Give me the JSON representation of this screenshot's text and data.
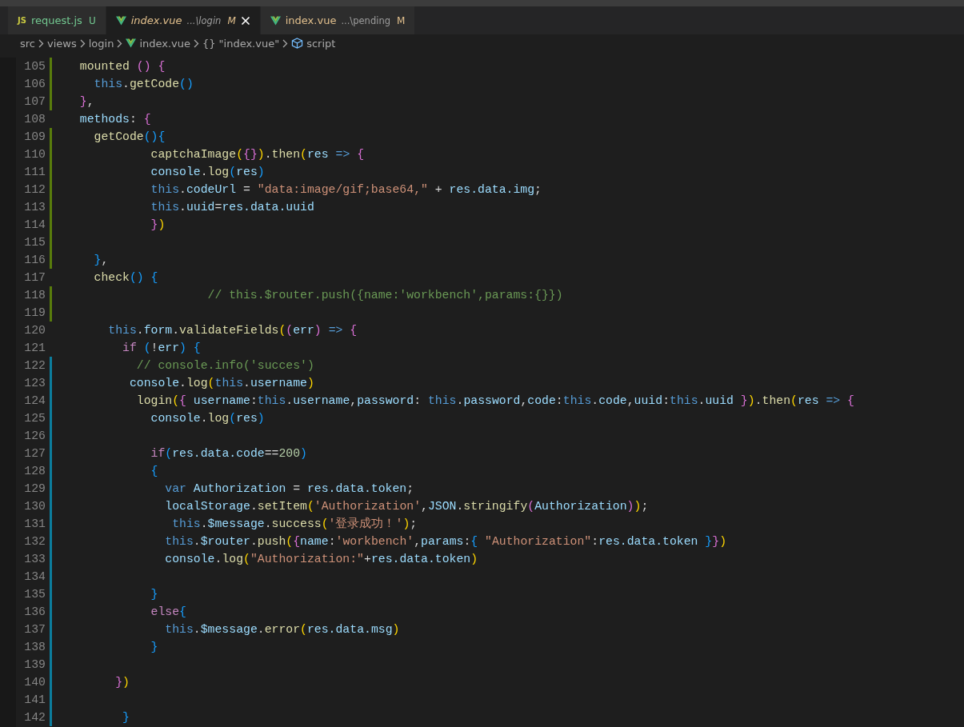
{
  "tabs": [
    {
      "kind": "js",
      "badge": "JS",
      "name": "request.js",
      "untracked": true,
      "git_letter": "U",
      "selected": false,
      "preview": false
    },
    {
      "kind": "vue",
      "name": "index.vue",
      "path": "...\\login",
      "untracked": false,
      "git_letter": "M",
      "selected": true,
      "preview": true
    },
    {
      "kind": "vue",
      "name": "index.vue",
      "path": "...\\pending",
      "untracked": false,
      "git_letter": "M",
      "selected": false,
      "preview": false
    }
  ],
  "breadcrumbs": [
    {
      "kind": "folder",
      "label": "src"
    },
    {
      "kind": "folder",
      "label": "views"
    },
    {
      "kind": "folder",
      "label": "login"
    },
    {
      "kind": "vue",
      "label": "index.vue"
    },
    {
      "kind": "object",
      "symbol": "{}",
      "label": "\"index.vue\""
    },
    {
      "kind": "module",
      "label": "script"
    }
  ],
  "lines": [
    {
      "number": "105",
      "kind": "added",
      "tokens": [
        {
          "text": "  mounted ",
          "kind": "f"
        },
        {
          "text": "() {",
          "kind": "b2"
        }
      ]
    },
    {
      "number": "106",
      "kind": "added",
      "tokens": [
        {
          "text": "    this",
          "kind": "k"
        },
        {
          "text": ".",
          "kind": "p"
        },
        {
          "text": "getCode",
          "kind": "f"
        },
        {
          "text": "()",
          "kind": "b3"
        }
      ]
    },
    {
      "number": "107",
      "kind": "added",
      "tokens": [
        {
          "text": "  }",
          "kind": "b2"
        },
        {
          "text": ",",
          "kind": "p"
        }
      ]
    },
    {
      "number": "108",
      "kind": "unchanged",
      "tokens": [
        {
          "text": "  methods",
          "kind": "v"
        },
        {
          "text": ": ",
          "kind": "p"
        },
        {
          "text": "{",
          "kind": "b2"
        }
      ]
    },
    {
      "number": "109",
      "kind": "added",
      "tokens": [
        {
          "text": "    getCode",
          "kind": "f"
        },
        {
          "text": "(){",
          "kind": "b3"
        }
      ]
    },
    {
      "number": "110",
      "kind": "added",
      "tokens": [
        {
          "text": "            captchaImage",
          "kind": "f"
        },
        {
          "text": "(",
          "kind": "b1"
        },
        {
          "text": "{}",
          "kind": "b2"
        },
        {
          "text": ")",
          "kind": "b1"
        },
        {
          "text": ".",
          "kind": "p"
        },
        {
          "text": "then",
          "kind": "f"
        },
        {
          "text": "(",
          "kind": "b1"
        },
        {
          "text": "res ",
          "kind": "v"
        },
        {
          "text": "=> ",
          "kind": "k"
        },
        {
          "text": "{",
          "kind": "b2"
        }
      ]
    },
    {
      "number": "111",
      "kind": "added",
      "tokens": [
        {
          "text": "            console",
          "kind": "v"
        },
        {
          "text": ".",
          "kind": "p"
        },
        {
          "text": "log",
          "kind": "f"
        },
        {
          "text": "(",
          "kind": "b3"
        },
        {
          "text": "res",
          "kind": "v"
        },
        {
          "text": ")",
          "kind": "b3"
        }
      ]
    },
    {
      "number": "112",
      "kind": "added",
      "tokens": [
        {
          "text": "            this",
          "kind": "k"
        },
        {
          "text": ".",
          "kind": "p"
        },
        {
          "text": "codeUrl",
          "kind": "v"
        },
        {
          "text": " = ",
          "kind": "p"
        },
        {
          "text": "\"data:image/gif;base64,\"",
          "kind": "s"
        },
        {
          "text": " + ",
          "kind": "p"
        },
        {
          "text": "res.data.img",
          "kind": "v"
        },
        {
          "text": ";",
          "kind": "p"
        }
      ]
    },
    {
      "number": "113",
      "kind": "added",
      "tokens": [
        {
          "text": "            this",
          "kind": "k"
        },
        {
          "text": ".",
          "kind": "p"
        },
        {
          "text": "uuid",
          "kind": "v"
        },
        {
          "text": "=",
          "kind": "p"
        },
        {
          "text": "res.data.uuid",
          "kind": "v"
        }
      ]
    },
    {
      "number": "114",
      "kind": "added",
      "tokens": [
        {
          "text": "            }",
          "kind": "b2"
        },
        {
          "text": ")",
          "kind": "b1"
        }
      ]
    },
    {
      "number": "115",
      "kind": "added"
    },
    {
      "number": "116",
      "kind": "added",
      "tokens": [
        {
          "text": "    }",
          "kind": "b3"
        },
        {
          "text": ",",
          "kind": "p"
        }
      ]
    },
    {
      "number": "117",
      "kind": "unchanged",
      "tokens": [
        {
          "text": "    check",
          "kind": "f"
        },
        {
          "text": "() {",
          "kind": "b3"
        }
      ]
    },
    {
      "number": "118",
      "kind": "added",
      "tokens": [
        {
          "text": "                    // this.$router.push({name:'workbench',params:{}})",
          "kind": "c"
        }
      ]
    },
    {
      "number": "119",
      "kind": "added"
    },
    {
      "number": "120",
      "kind": "unchanged",
      "tokens": [
        {
          "text": "      this",
          "kind": "k"
        },
        {
          "text": ".",
          "kind": "p"
        },
        {
          "text": "form",
          "kind": "v"
        },
        {
          "text": ".",
          "kind": "p"
        },
        {
          "text": "validateFields",
          "kind": "f"
        },
        {
          "text": "(",
          "kind": "b1"
        },
        {
          "text": "(",
          "kind": "b2"
        },
        {
          "text": "err",
          "kind": "v"
        },
        {
          "text": ") ",
          "kind": "b2"
        },
        {
          "text": "=> ",
          "kind": "k"
        },
        {
          "text": "{",
          "kind": "b2"
        }
      ]
    },
    {
      "number": "121",
      "kind": "unchanged",
      "tokens": [
        {
          "text": "        if ",
          "kind": "ctl"
        },
        {
          "text": "(",
          "kind": "b3"
        },
        {
          "text": "!",
          "kind": "p"
        },
        {
          "text": "err",
          "kind": "v"
        },
        {
          "text": ") {",
          "kind": "b3"
        }
      ]
    },
    {
      "number": "122",
      "kind": "modified",
      "tokens": [
        {
          "text": "          // console.info('succes')",
          "kind": "c"
        }
      ]
    },
    {
      "number": "123",
      "kind": "modified",
      "tokens": [
        {
          "text": "         console",
          "kind": "v"
        },
        {
          "text": ".",
          "kind": "p"
        },
        {
          "text": "log",
          "kind": "f"
        },
        {
          "text": "(",
          "kind": "b1"
        },
        {
          "text": "this",
          "kind": "k"
        },
        {
          "text": ".",
          "kind": "p"
        },
        {
          "text": "username",
          "kind": "v"
        },
        {
          "text": ")",
          "kind": "b1"
        }
      ]
    },
    {
      "number": "124",
      "kind": "modified",
      "tokens": [
        {
          "text": "          login",
          "kind": "f"
        },
        {
          "text": "(",
          "kind": "b1"
        },
        {
          "text": "{",
          "kind": "b2"
        },
        {
          "text": " username",
          "kind": "v"
        },
        {
          "text": ":",
          "kind": "p"
        },
        {
          "text": "this",
          "kind": "k"
        },
        {
          "text": ".",
          "kind": "p"
        },
        {
          "text": "username",
          "kind": "v"
        },
        {
          "text": ",",
          "kind": "p"
        },
        {
          "text": "password",
          "kind": "v"
        },
        {
          "text": ": ",
          "kind": "p"
        },
        {
          "text": "this",
          "kind": "k"
        },
        {
          "text": ".",
          "kind": "p"
        },
        {
          "text": "password",
          "kind": "v"
        },
        {
          "text": ",",
          "kind": "p"
        },
        {
          "text": "code",
          "kind": "v"
        },
        {
          "text": ":",
          "kind": "p"
        },
        {
          "text": "this",
          "kind": "k"
        },
        {
          "text": ".",
          "kind": "p"
        },
        {
          "text": "code",
          "kind": "v"
        },
        {
          "text": ",",
          "kind": "p"
        },
        {
          "text": "uuid",
          "kind": "v"
        },
        {
          "text": ":",
          "kind": "p"
        },
        {
          "text": "this",
          "kind": "k"
        },
        {
          "text": ".",
          "kind": "p"
        },
        {
          "text": "uuid ",
          "kind": "v"
        },
        {
          "text": "}",
          "kind": "b2"
        },
        {
          "text": ")",
          "kind": "b1"
        },
        {
          "text": ".",
          "kind": "p"
        },
        {
          "text": "then",
          "kind": "f"
        },
        {
          "text": "(",
          "kind": "b1"
        },
        {
          "text": "res ",
          "kind": "v"
        },
        {
          "text": "=> ",
          "kind": "k"
        },
        {
          "text": "{",
          "kind": "b2"
        }
      ]
    },
    {
      "number": "125",
      "kind": "modified",
      "tokens": [
        {
          "text": "            console",
          "kind": "v"
        },
        {
          "text": ".",
          "kind": "p"
        },
        {
          "text": "log",
          "kind": "f"
        },
        {
          "text": "(",
          "kind": "b3"
        },
        {
          "text": "res",
          "kind": "v"
        },
        {
          "text": ")",
          "kind": "b3"
        }
      ]
    },
    {
      "number": "126",
      "kind": "modified"
    },
    {
      "number": "127",
      "kind": "modified",
      "tokens": [
        {
          "text": "            if",
          "kind": "ctl"
        },
        {
          "text": "(",
          "kind": "b3"
        },
        {
          "text": "res.data.code",
          "kind": "v"
        },
        {
          "text": "==",
          "kind": "p"
        },
        {
          "text": "200",
          "kind": "n"
        },
        {
          "text": ")",
          "kind": "b3"
        }
      ]
    },
    {
      "number": "128",
      "kind": "modified",
      "tokens": [
        {
          "text": "            {",
          "kind": "b3"
        }
      ]
    },
    {
      "number": "129",
      "kind": "modified",
      "tokens": [
        {
          "text": "              var ",
          "kind": "k"
        },
        {
          "text": "Authorization",
          "kind": "v"
        },
        {
          "text": " = ",
          "kind": "p"
        },
        {
          "text": "res.data.token",
          "kind": "v"
        },
        {
          "text": ";",
          "kind": "p"
        }
      ]
    },
    {
      "number": "130",
      "kind": "modified",
      "tokens": [
        {
          "text": "              localStorage",
          "kind": "v"
        },
        {
          "text": ".",
          "kind": "p"
        },
        {
          "text": "setItem",
          "kind": "f"
        },
        {
          "text": "(",
          "kind": "b1"
        },
        {
          "text": "'Authorization'",
          "kind": "s"
        },
        {
          "text": ",",
          "kind": "p"
        },
        {
          "text": "JSON",
          "kind": "v"
        },
        {
          "text": ".",
          "kind": "p"
        },
        {
          "text": "stringify",
          "kind": "f"
        },
        {
          "text": "(",
          "kind": "b2"
        },
        {
          "text": "Authorization",
          "kind": "v"
        },
        {
          "text": ")",
          "kind": "b2"
        },
        {
          "text": ")",
          "kind": "b1"
        },
        {
          "text": ";",
          "kind": "p"
        }
      ]
    },
    {
      "number": "131",
      "kind": "modified",
      "tokens": [
        {
          "text": "               this",
          "kind": "k"
        },
        {
          "text": ".",
          "kind": "p"
        },
        {
          "text": "$message",
          "kind": "v"
        },
        {
          "text": ".",
          "kind": "p"
        },
        {
          "text": "success",
          "kind": "f"
        },
        {
          "text": "(",
          "kind": "b1"
        },
        {
          "text": "'登录成功！'",
          "kind": "s"
        },
        {
          "text": ")",
          "kind": "b1"
        },
        {
          "text": ";",
          "kind": "p"
        }
      ]
    },
    {
      "number": "132",
      "kind": "modified",
      "tokens": [
        {
          "text": "              this",
          "kind": "k"
        },
        {
          "text": ".",
          "kind": "p"
        },
        {
          "text": "$router",
          "kind": "v"
        },
        {
          "text": ".",
          "kind": "p"
        },
        {
          "text": "push",
          "kind": "f"
        },
        {
          "text": "(",
          "kind": "b1"
        },
        {
          "text": "{",
          "kind": "b2"
        },
        {
          "text": "name",
          "kind": "v"
        },
        {
          "text": ":",
          "kind": "p"
        },
        {
          "text": "'workbench'",
          "kind": "s"
        },
        {
          "text": ",",
          "kind": "p"
        },
        {
          "text": "params",
          "kind": "v"
        },
        {
          "text": ":",
          "kind": "p"
        },
        {
          "text": "{ ",
          "kind": "b3"
        },
        {
          "text": "\"Authorization\"",
          "kind": "s"
        },
        {
          "text": ":",
          "kind": "p"
        },
        {
          "text": "res.data.token ",
          "kind": "v"
        },
        {
          "text": "}",
          "kind": "b3"
        },
        {
          "text": "}",
          "kind": "b2"
        },
        {
          "text": ")",
          "kind": "b1"
        }
      ]
    },
    {
      "number": "133",
      "kind": "modified",
      "tokens": [
        {
          "text": "              console",
          "kind": "v"
        },
        {
          "text": ".",
          "kind": "p"
        },
        {
          "text": "log",
          "kind": "f"
        },
        {
          "text": "(",
          "kind": "b1"
        },
        {
          "text": "\"Authorization:\"",
          "kind": "s"
        },
        {
          "text": "+",
          "kind": "p"
        },
        {
          "text": "res.data.token",
          "kind": "v"
        },
        {
          "text": ")",
          "kind": "b1"
        }
      ]
    },
    {
      "number": "134",
      "kind": "modified"
    },
    {
      "number": "135",
      "kind": "modified",
      "tokens": [
        {
          "text": "            }",
          "kind": "b3"
        }
      ]
    },
    {
      "number": "136",
      "kind": "modified",
      "tokens": [
        {
          "text": "            else",
          "kind": "ctl"
        },
        {
          "text": "{",
          "kind": "b3"
        }
      ]
    },
    {
      "number": "137",
      "kind": "modified",
      "tokens": [
        {
          "text": "              this",
          "kind": "k"
        },
        {
          "text": ".",
          "kind": "p"
        },
        {
          "text": "$message",
          "kind": "v"
        },
        {
          "text": ".",
          "kind": "p"
        },
        {
          "text": "error",
          "kind": "f"
        },
        {
          "text": "(",
          "kind": "b1"
        },
        {
          "text": "res.data.msg",
          "kind": "v"
        },
        {
          "text": ")",
          "kind": "b1"
        }
      ]
    },
    {
      "number": "138",
      "kind": "modified",
      "tokens": [
        {
          "text": "            }",
          "kind": "b3"
        }
      ]
    },
    {
      "number": "139",
      "kind": "modified"
    },
    {
      "number": "140",
      "kind": "modified",
      "tokens": [
        {
          "text": "       }",
          "kind": "b2"
        },
        {
          "text": ")",
          "kind": "b1"
        }
      ]
    },
    {
      "number": "141",
      "kind": "modified"
    },
    {
      "number": "142",
      "kind": "modified",
      "tokens": [
        {
          "text": "        }",
          "kind": "b3"
        }
      ]
    }
  ]
}
